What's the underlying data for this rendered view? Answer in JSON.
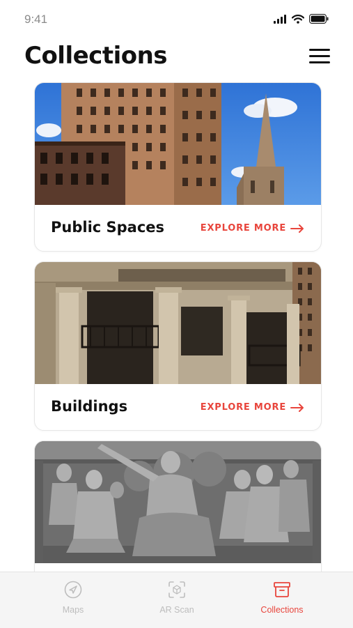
{
  "status_bar": {
    "time": "9:41"
  },
  "header": {
    "title": "Collections"
  },
  "cards": [
    {
      "title": "Public Spaces",
      "action": "EXPLORE MORE"
    },
    {
      "title": "Buildings",
      "action": "EXPLORE MORE"
    },
    {
      "title": "",
      "action": ""
    }
  ],
  "tab_bar": {
    "tabs": [
      {
        "label": "Maps",
        "icon": "navigation-arrow-icon",
        "active": false
      },
      {
        "label": "AR Scan",
        "icon": "scan-frame-icon",
        "active": false
      },
      {
        "label": "Collections",
        "icon": "archive-box-icon",
        "active": true
      }
    ]
  },
  "colors": {
    "accent": "#e8453c",
    "text": "#111111",
    "inactive": "#bdbdbd",
    "tab_bg": "#f5f5f5"
  }
}
